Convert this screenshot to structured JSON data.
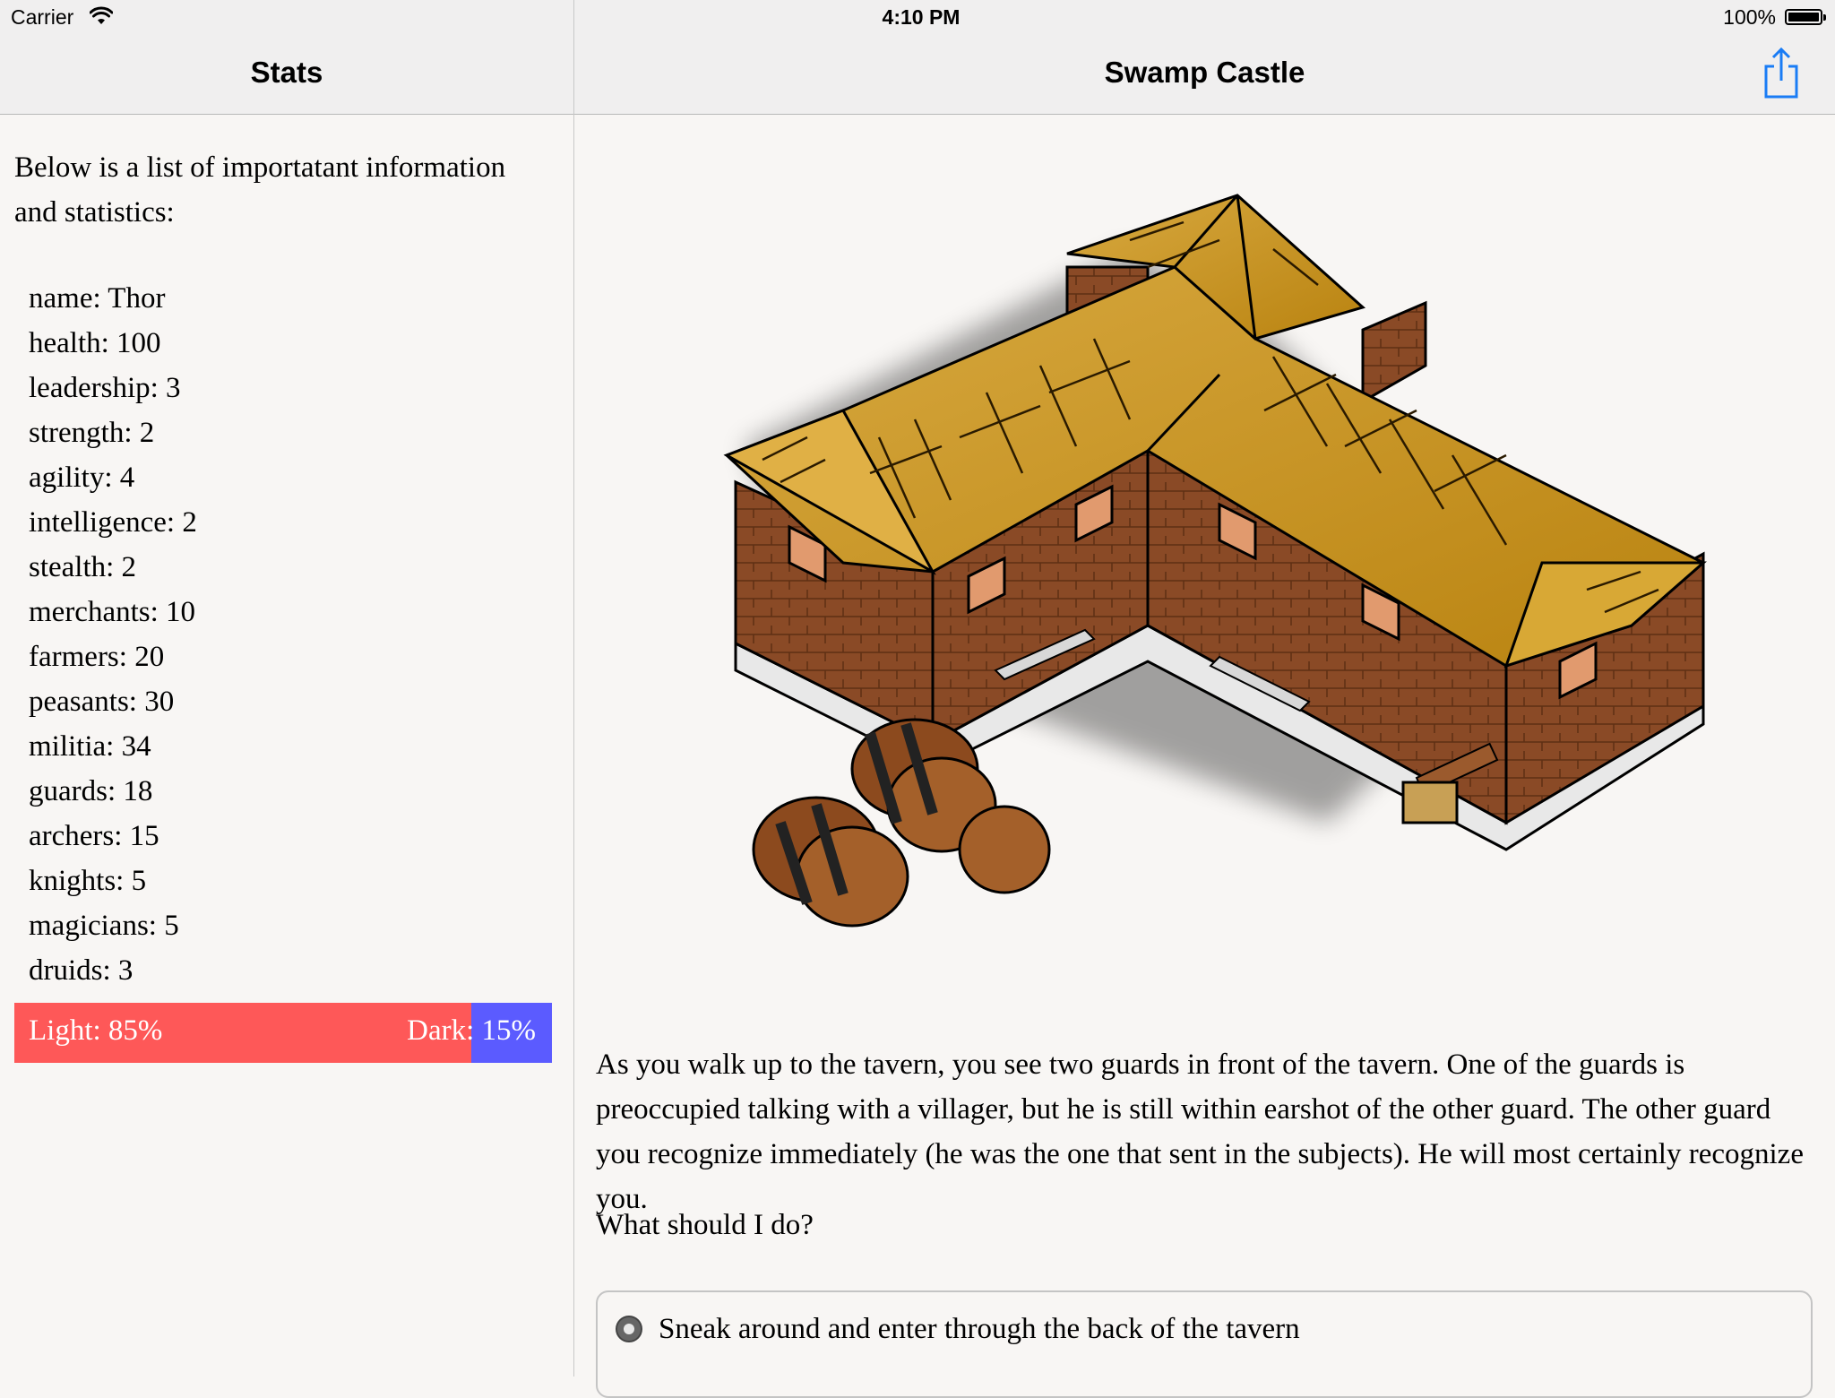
{
  "status_bar": {
    "carrier": "Carrier",
    "time": "4:10 PM",
    "battery": "100%"
  },
  "left_nav": {
    "title": "Stats"
  },
  "right_nav": {
    "title": "Swamp Castle",
    "share_icon": "share-icon"
  },
  "stats_panel": {
    "intro": "Below is a list of importatant information and statistics:",
    "items": [
      "name: Thor",
      "health: 100",
      "leadership: 3",
      "strength: 2",
      "agility: 4",
      "intelligence: 2",
      "stealth: 2",
      "merchants: 10",
      "farmers: 20",
      "peasants: 30",
      "militia: 34",
      "guards: 18",
      "archers: 15",
      "knights: 5",
      "magicians: 5",
      "druids: 3"
    ],
    "alignment": {
      "light_label": "Light: 85%",
      "dark_label": "Dark: 15%",
      "light_fraction": 0.85,
      "light_color": "#fe5858",
      "dark_color": "#5b5bff"
    }
  },
  "story": {
    "illustration": "tavern-building-illustration",
    "text": "As you walk up to the tavern, you see two guards in front of the tavern. One of the guards is preoccupied talking with a villager, but he is still within earshot of the other guard. The other guard you recognize immediately (he was the one that sent in the subjects). He will most certainly recognize you.",
    "question": "What should I do?",
    "choices": [
      {
        "label": "Sneak around and enter through the back of the tavern",
        "selected": true
      }
    ]
  },
  "colors": {
    "accent": "#1a7cf5",
    "bar_background": "#f0efef",
    "page_background": "#f8f6f4"
  }
}
